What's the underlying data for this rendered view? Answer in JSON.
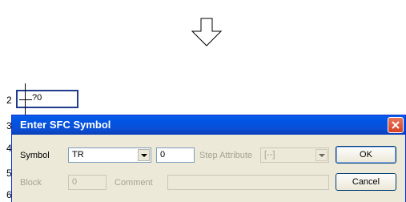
{
  "ladder": {
    "row_numbers": [
      "2",
      "3",
      "4",
      "5",
      "6"
    ],
    "cell_text": "?0"
  },
  "dialog": {
    "title": "Enter SFC Symbol",
    "symbol_label": "Symbol",
    "symbol_value": "TR",
    "number_value": "0",
    "step_attribute_label": "Step Attribute",
    "step_attribute_value": "[--]",
    "block_label": "Block",
    "block_value": "0",
    "comment_label": "Comment",
    "comment_value": "",
    "ok_label": "OK",
    "cancel_label": "Cancel"
  }
}
